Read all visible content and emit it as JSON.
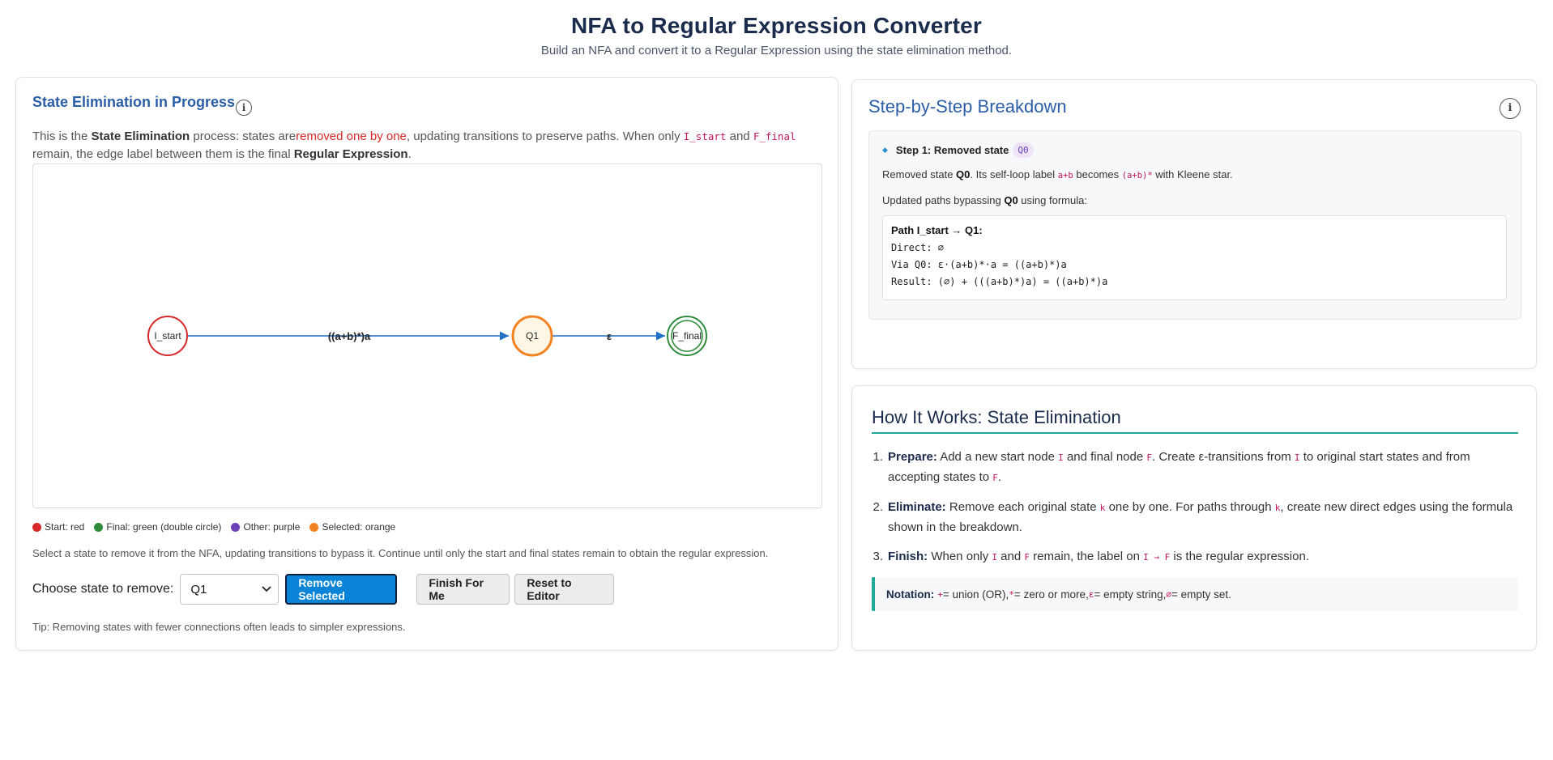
{
  "header": {
    "title": "NFA to Regular Expression Converter",
    "subtitle": "Build an NFA and convert it to a Regular Expression using the state elimination method."
  },
  "left_panel": {
    "title": "State Elimination in Progress",
    "info_glyph": "i",
    "explain": {
      "p1": "This is the ",
      "bold1": "State Elimination",
      "p2": " process: states are",
      "red": "removed one by one",
      "p3": ", updating transitions to preserve paths. When only ",
      "code1": "I_start",
      "p4": " and ",
      "code2": "F_final",
      "p5": " remain, the edge label between them is the final ",
      "bold2": "Regular Expression",
      "p6": "."
    },
    "graph": {
      "nodes": [
        {
          "id": "I_start",
          "label": "I_start",
          "kind": "start"
        },
        {
          "id": "Q1",
          "label": "Q1",
          "kind": "selected"
        },
        {
          "id": "F_final",
          "label": "F_final",
          "kind": "final"
        }
      ],
      "edges": [
        {
          "from": "I_start",
          "to": "Q1",
          "label": "((a+b)*)a"
        },
        {
          "from": "Q1",
          "to": "F_final",
          "label": "ε"
        }
      ]
    },
    "legend": [
      {
        "label": "Start: red",
        "color": "#d62828"
      },
      {
        "label": "Final: green (double circle)",
        "color": "#2e8b3a"
      },
      {
        "label": "Other: purple",
        "color": "#6b3fb5"
      },
      {
        "label": "Selected: orange",
        "color": "#f58220"
      }
    ],
    "hint": "Select a state to remove it from the NFA, updating transitions to bypass it. Continue until only the start and final states remain to obtain the regular expression.",
    "controls": {
      "choose_label": "Choose state to remove:",
      "selected_state": "Q1",
      "remove_label": "Remove Selected",
      "finish_label": "Finish For Me",
      "reset_label": "Reset to Editor"
    },
    "tip": "Tip: Removing states with fewer connections often leads to simpler expressions."
  },
  "steps_panel": {
    "title": "Step-by-Step Breakdown",
    "info_glyph": "i",
    "step": {
      "heading": "Step 1: Removed state",
      "badge": "Q0",
      "line1": {
        "a": "Removed state ",
        "b": "Q0",
        "c": ". Its self-loop label ",
        "code1": "a+b",
        "d": " becomes ",
        "code2": "(a+b)*",
        "e": " with Kleene star."
      },
      "line2": {
        "a": "Updated paths bypassing ",
        "b": "Q0",
        "c": " using formula:"
      },
      "formula": {
        "title": "Path I_start → Q1:",
        "direct": "Direct: ∅",
        "via": "Via Q0: ε·(a+b)*·a = ((a+b)*)a",
        "result": "Result: (∅) + (((a+b)*)a) = ((a+b)*)a"
      }
    }
  },
  "how_panel": {
    "title": "How It Works: State Elimination",
    "items": [
      {
        "num": "1.",
        "bold": "Prepare:",
        "t1": " Add a new start node ",
        "c1": "I",
        "t2": " and final node ",
        "c2": "F",
        "t3": ". Create ε-transitions from ",
        "c3": "I",
        "t4": " to original start states and from accepting states to ",
        "c4": "F",
        "t5": "."
      },
      {
        "num": "2.",
        "bold": "Eliminate:",
        "t1": " Remove each original state ",
        "c1": "k",
        "t2": " one by one. For paths through ",
        "c2": "k",
        "t3": ", create new direct edges using the formula shown in the breakdown."
      },
      {
        "num": "3.",
        "bold": "Finish:",
        "t1": " When only ",
        "c1": "I",
        "t2": " and ",
        "c2": "F",
        "t3": " remain, the label on ",
        "c3": "I → F",
        "t4": " is the regular expression."
      }
    ],
    "notation": {
      "bold": "Notation:",
      "c1": "+",
      "t1": " = union (OR), ",
      "c2": "*",
      "t2": " = zero or more, ",
      "c3": "ε",
      "t3": " = empty string, ",
      "c4": "∅",
      "t4": " = empty set."
    }
  },
  "colors": {
    "accent_blue": "#2b5ea7",
    "primary_button": "#0a84d6",
    "teal_rule": "#1fab97",
    "start_node": "#d62828",
    "final_node": "#2e8b3a",
    "selected_node": "#f58220",
    "edge": "#1f6fc5"
  }
}
